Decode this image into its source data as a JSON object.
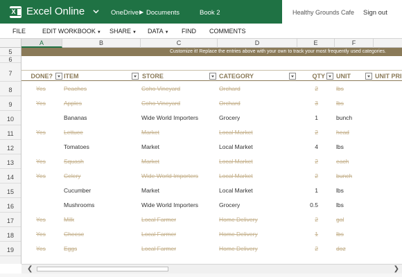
{
  "app": {
    "name": "Excel Online",
    "breadcrumb": [
      "OneDrive",
      "Documents"
    ],
    "book": "Book 2",
    "owner": "Healthy Grounds Cafe",
    "signout": "Sign out",
    "brand_color": "#1f7244"
  },
  "menu": {
    "file": "FILE",
    "edit": "EDIT WORKBOOK",
    "share": "SHARE",
    "data": "DATA",
    "find": "FIND",
    "comments": "COMMENTS"
  },
  "columns": [
    "A",
    "B",
    "C",
    "D",
    "E",
    "F"
  ],
  "row_numbers": [
    "5",
    "6",
    "7",
    "8",
    "9",
    "10",
    "11",
    "12",
    "13",
    "14",
    "15",
    "16",
    "17",
    "18",
    "19"
  ],
  "banner": "Customize it! Replace the entries above with your own to track your most frequently used categories.",
  "headers": {
    "done": "DONE?",
    "item": "ITEM",
    "store": "STORE",
    "category": "CATEGORY",
    "qty": "QTY",
    "unit": "UNIT",
    "unit_price": "UNIT PRI"
  },
  "rows": [
    {
      "done": "Yes",
      "item": "Peaches",
      "store": "Coho Vineyard",
      "category": "Orchard",
      "qty": "2",
      "unit": "lbs"
    },
    {
      "done": "Yes",
      "item": "Apples",
      "store": "Coho Vineyard",
      "category": "Orchard",
      "qty": "3",
      "unit": "lbs"
    },
    {
      "done": "",
      "item": "Bananas",
      "store": "Wide World Importers",
      "category": "Grocery",
      "qty": "1",
      "unit": "bunch"
    },
    {
      "done": "Yes",
      "item": "Lettuce",
      "store": "Market",
      "category": "Local Market",
      "qty": "2",
      "unit": "head"
    },
    {
      "done": "",
      "item": "Tomatoes",
      "store": "Market",
      "category": "Local Market",
      "qty": "4",
      "unit": "lbs"
    },
    {
      "done": "Yes",
      "item": "Squash",
      "store": "Market",
      "category": "Local Market",
      "qty": "2",
      "unit": "each"
    },
    {
      "done": "Yes",
      "item": "Celery",
      "store": "Wide World Importers",
      "category": "Local Market",
      "qty": "2",
      "unit": "bunch"
    },
    {
      "done": "",
      "item": "Cucumber",
      "store": "Market",
      "category": "Local Market",
      "qty": "1",
      "unit": "lbs"
    },
    {
      "done": "",
      "item": "Mushrooms",
      "store": "Wide World Importers",
      "category": "Grocery",
      "qty": "0.5",
      "unit": "lbs"
    },
    {
      "done": "Yes",
      "item": "Milk",
      "store": "Local Farmer",
      "category": "Home Delivery",
      "qty": "2",
      "unit": "gal"
    },
    {
      "done": "Yes",
      "item": "Cheese",
      "store": "Local Farmer",
      "category": "Home Delivery",
      "qty": "1",
      "unit": "lbs"
    },
    {
      "done": "Yes",
      "item": "Eggs",
      "store": "Local Farmer",
      "category": "Home Delivery",
      "qty": "2",
      "unit": "doz"
    }
  ]
}
